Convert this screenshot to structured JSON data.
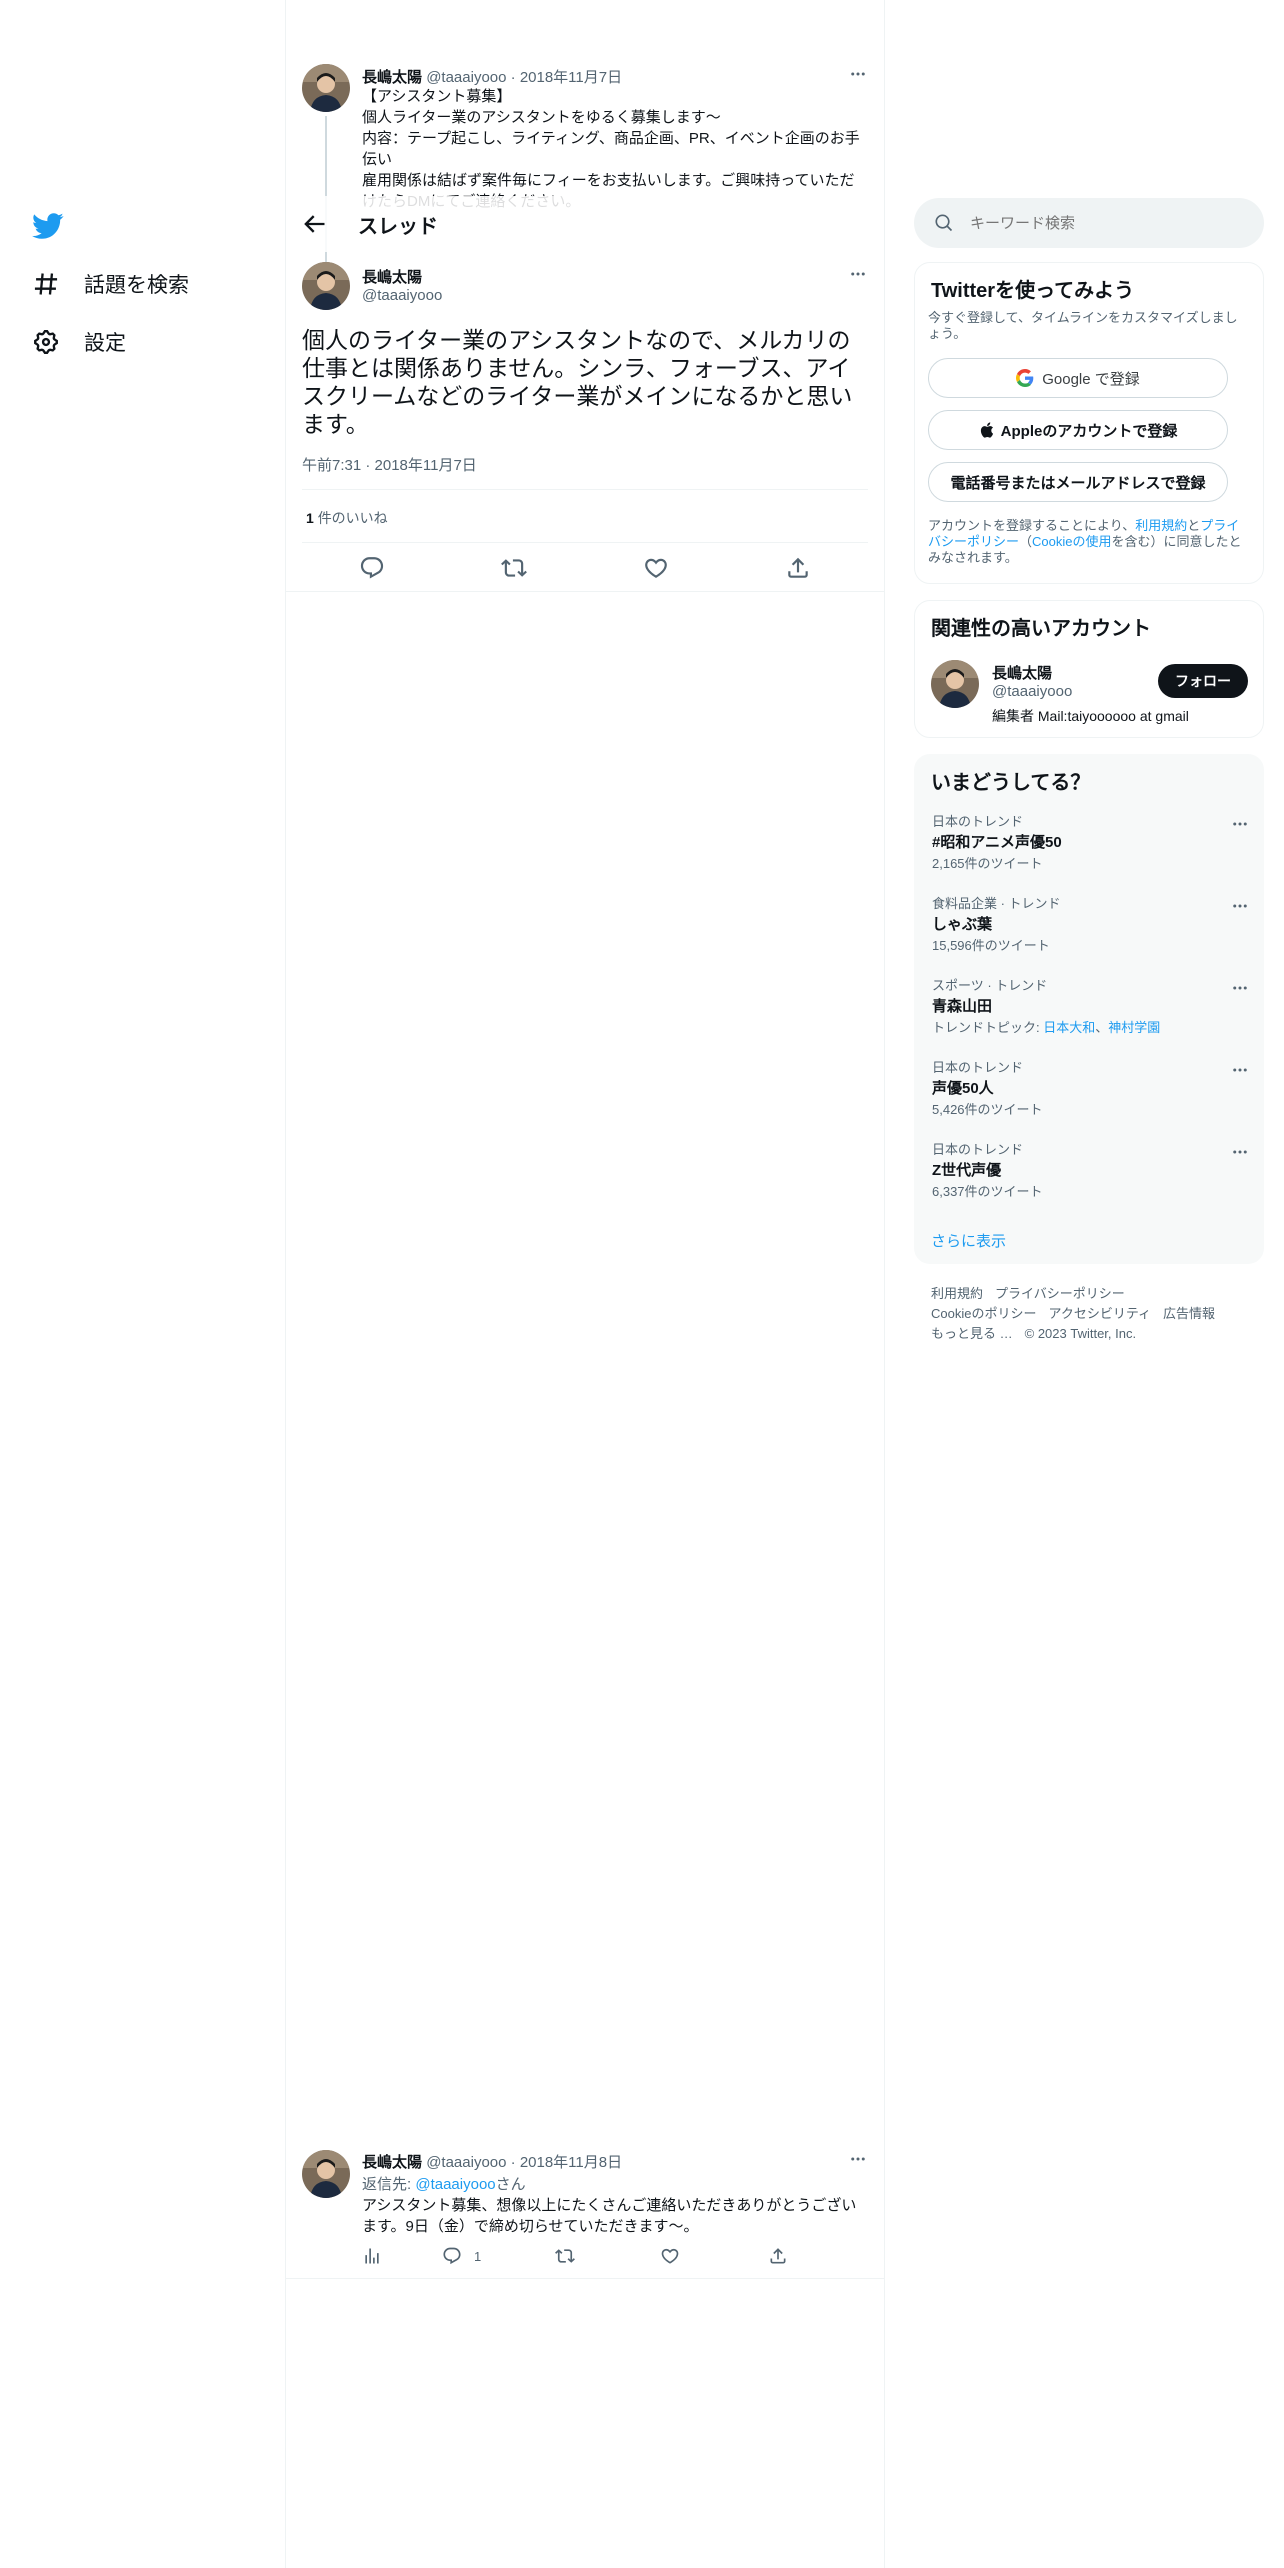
{
  "nav": {
    "explore_label": "話題を検索",
    "settings_label": "設定"
  },
  "header": {
    "title": "スレッド"
  },
  "parent_tweet": {
    "name": "長嶋太陽",
    "handle": "@taaaiyooo",
    "date": "2018年11月7日",
    "lines": [
      "【アシスタント募集】",
      "個人ライター業のアシスタントをゆるく募集します〜",
      "内容：テープ起こし、ライティング、商品企画、PR、イベント企画のお手伝い",
      "雇用関係は結ばず案件毎にフィーをお支払いします。ご興味持っていただけたらDMにてご連絡ください。"
    ]
  },
  "main_tweet": {
    "name": "長嶋太陽",
    "handle": "@taaaiyooo",
    "text": "個人のライター業のアシスタントなので、メルカリの仕事とは関係ありません。シンラ、フォーブス、アイスクリームなどのライター業がメインになるかと思います。",
    "timestamp": "午前7:31 · 2018年11月7日",
    "likes_count": "1",
    "likes_label": "件のいいね"
  },
  "reply_tweet": {
    "name": "長嶋太陽",
    "handle": "@taaaiyooo",
    "date": "2018年11月8日",
    "reply_prefix": "返信先: ",
    "reply_to": "@taaaiyooo",
    "reply_suffix": "さん",
    "text": "アシスタント募集、想像以上にたくさんご連絡いただきありがとうございます。9日（金）で締め切らせていただきます〜。",
    "reply_count": "1"
  },
  "search": {
    "placeholder": "キーワード検索"
  },
  "signup": {
    "title": "Twitterを使ってみよう",
    "subtitle": "今すぐ登録して、タイムラインをカスタマイズしましょう。",
    "google_label": "Google で登録",
    "apple_label": "Appleのアカウントで登録",
    "phone_label": "電話番号またはメールアドレスで登録",
    "legal_1": "アカウントを登録することにより、",
    "legal_terms": "利用規約",
    "legal_2": "と",
    "legal_privacy": "プライバシーポリシー",
    "legal_3": "（",
    "legal_cookie": "Cookieの使用",
    "legal_4": "を含む）に同意したとみなされます。"
  },
  "related": {
    "title": "関連性の高いアカウント",
    "name": "長嶋太陽",
    "handle": "@taaaiyooo",
    "bio": "編集者 Mail:taiyoooooo at gmail",
    "follow_label": "フォロー"
  },
  "trends": {
    "title": "いまどうしてる？",
    "items": [
      {
        "meta": "日本のトレンド",
        "name": "#昭和アニメ声優50",
        "count": "2,165件のツイート"
      },
      {
        "meta": "食料品企業 · トレンド",
        "name": "しゃぶ葉",
        "count": "15,596件のツイート"
      },
      {
        "meta": "スポーツ · トレンド",
        "name": "青森山田",
        "topic_prefix": "トレンドトピック: ",
        "topic_1": "日本大和",
        "topic_sep": "、",
        "topic_2": "神村学園"
      },
      {
        "meta": "日本のトレンド",
        "name": "声優50人",
        "count": "5,426件のツイート"
      },
      {
        "meta": "日本のトレンド",
        "name": "Z世代声優",
        "count": "6,337件のツイート"
      }
    ],
    "show_more": "さらに表示"
  },
  "footer": {
    "terms": "利用規約",
    "privacy": "プライバシーポリシー",
    "cookie": "Cookieのポリシー",
    "accessibility": "アクセシビリティ",
    "ads": "広告情報",
    "more": "もっと見る …",
    "copyright": "© 2023 Twitter, Inc."
  },
  "colors": {
    "accent": "#1d9bf0",
    "text": "#0f1419",
    "muted": "#536471",
    "panel_bg": "#f7f9f9",
    "search_bg": "#eff3f4",
    "divider": "#eff3f4"
  }
}
